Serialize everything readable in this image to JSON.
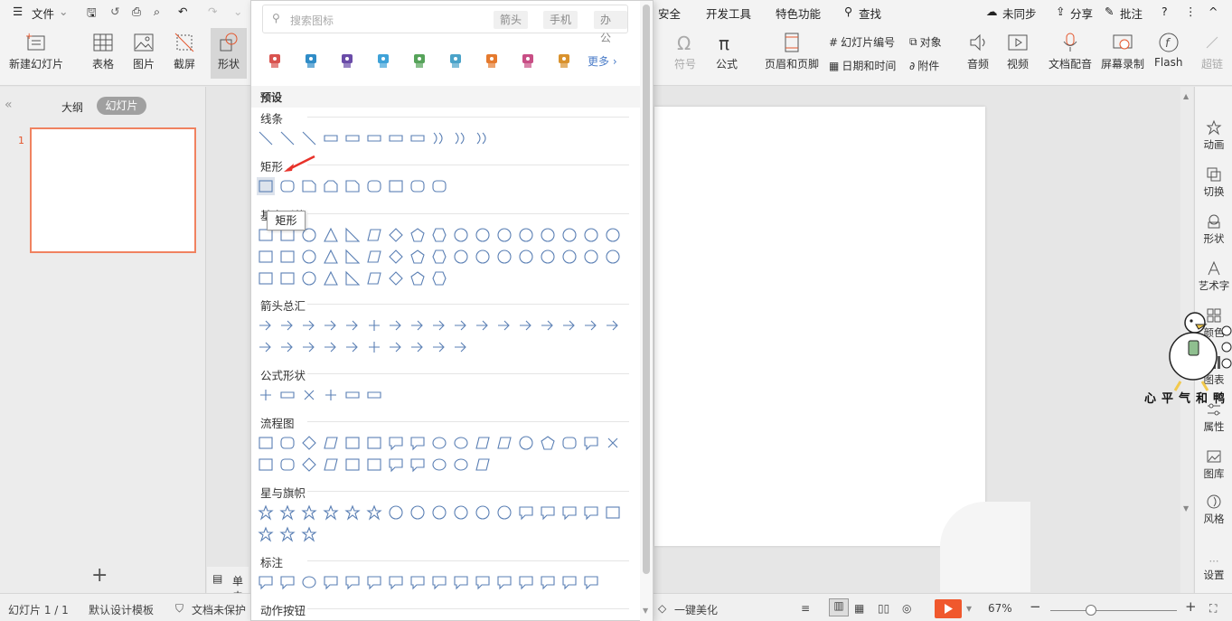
{
  "menubar": {
    "file": "文件",
    "security": "安全",
    "dev_tools": "开发工具",
    "special": "特色功能",
    "find": "查找",
    "sync": "未同步",
    "share": "分享",
    "comment": "批注"
  },
  "ribbon": {
    "new_slide": "新建幻灯片",
    "table": "表格",
    "image": "图片",
    "screenshot": "截屏",
    "shape": "形状",
    "symbol": "符号",
    "formula": "公式",
    "header_footer": "页眉和页脚",
    "slide_number": "幻灯片编号",
    "object": "对象",
    "datetime": "日期和时间",
    "attachment": "附件",
    "audio": "音频",
    "video": "视频",
    "narration": "文档配音",
    "screen_record": "屏幕录制",
    "flash": "Flash",
    "hyperlink": "超链"
  },
  "leftpane": {
    "tab_outline": "大纲",
    "tab_slides": "幻灯片",
    "slide_number": "1"
  },
  "rightpane": {
    "animation": "动画",
    "transition": "切换",
    "shape": "形状",
    "wordart": "艺术字",
    "color": "颜色",
    "chart": "图表",
    "property": "属性",
    "gallery": "图库",
    "style": "风格",
    "settings": "设置"
  },
  "statusbar": {
    "slide_count": "幻灯片 1 / 1",
    "template": "默认设计模板",
    "protect": "文档未保护",
    "beautify": "一键美化",
    "zoom": "67%",
    "notes": "单击"
  },
  "panel": {
    "search_placeholder": "搜索图标",
    "tags": [
      "箭头",
      "手机",
      "办公"
    ],
    "more": "更多",
    "preset": "预设",
    "tooltip": "矩形",
    "categories": {
      "lines": "线条",
      "rect": "矩形",
      "basic": "基本形状",
      "arrows": "箭头总汇",
      "formula": "公式形状",
      "flow": "流程图",
      "stars": "星与旗帜",
      "callouts": "标注",
      "actions": "动作按钮"
    }
  },
  "sticker": {
    "text": "心平气和鸭"
  },
  "colors": {
    "accent": "#e4572e",
    "panel_stroke": "#5a7fb4",
    "play": "#f0582d"
  }
}
